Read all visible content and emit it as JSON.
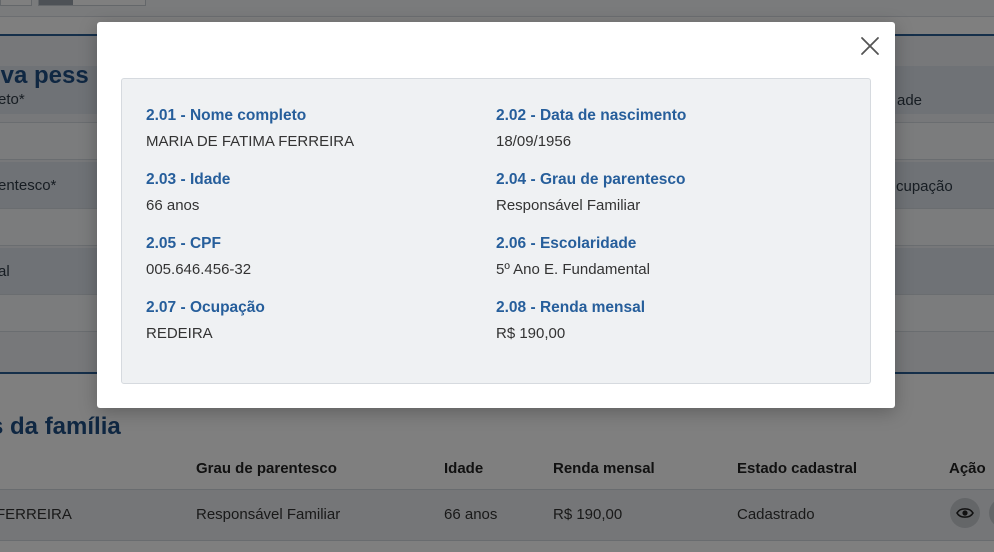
{
  "background": {
    "form": {
      "title": "ova pess",
      "labels": [
        "eto*",
        "ade",
        "entesco*",
        "cupação",
        "al"
      ]
    },
    "family": {
      "title": "s da família",
      "headers": [
        "Grau de parentesco",
        "Idade",
        "Renda mensal",
        "Estado cadastral",
        "Ação"
      ],
      "row": [
        "FERREIRA",
        "Responsável Familiar",
        "66 anos",
        "R$ 190,00",
        "Cadastrado"
      ]
    }
  },
  "modal": {
    "close_icon": "close-icon",
    "fields": [
      {
        "label": "2.01 - Nome completo",
        "value": "MARIA DE FATIMA FERREIRA"
      },
      {
        "label": "2.02 - Data de nascimento",
        "value": "18/09/1956"
      },
      {
        "label": "2.03 - Idade",
        "value": "66 anos"
      },
      {
        "label": "2.04 - Grau de parentesco",
        "value": "Responsável Familiar"
      },
      {
        "label": "2.05 - CPF",
        "value": "005.646.456-32"
      },
      {
        "label": "2.06 - Escolaridade",
        "value": "5º Ano E. Fundamental"
      },
      {
        "label": "2.07 - Ocupação",
        "value": "REDEIRA"
      },
      {
        "label": "2.08 - Renda mensal",
        "value": "R$ 190,00"
      }
    ]
  },
  "colors": {
    "accent": "#265e9b",
    "overlay": "rgba(0,0,0,0.5)"
  }
}
